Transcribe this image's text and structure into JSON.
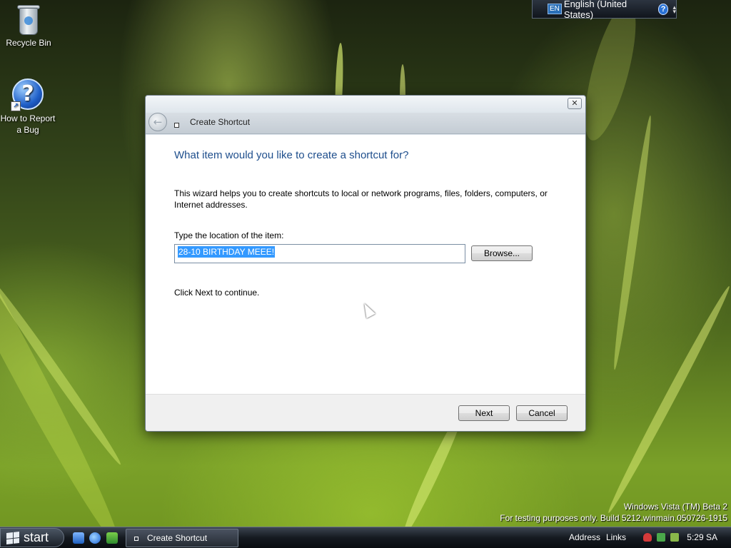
{
  "desktop": {
    "icons": [
      {
        "label": "Recycle Bin"
      },
      {
        "label": "How to Report a Bug"
      }
    ],
    "watermark": {
      "line1": "Windows Vista (TM) Beta 2",
      "line2": "For testing purposes only. Build 5212.winmain.050726-1915"
    }
  },
  "language_bar": {
    "code": "EN",
    "language": "English (United States)",
    "help_symbol": "?"
  },
  "dialog": {
    "title": "Create Shortcut",
    "close_symbol": "✕",
    "back_symbol": "←",
    "heading": "What item would you like to create a shortcut for?",
    "description": "This wizard helps you to create shortcuts to local or network programs, files, folders, computers, or Internet addresses.",
    "location_label": "Type the location of the item:",
    "location_value": "28-10 BIRTHDAY MEEE!",
    "browse_label": "Browse...",
    "continue_text": "Click Next to continue.",
    "next_label": "Next",
    "cancel_label": "Cancel"
  },
  "taskbar": {
    "start_label": "start",
    "task_label": "Create Shortcut",
    "address_label": "Address",
    "links_label": "Links",
    "clock": "5:29 SA"
  }
}
